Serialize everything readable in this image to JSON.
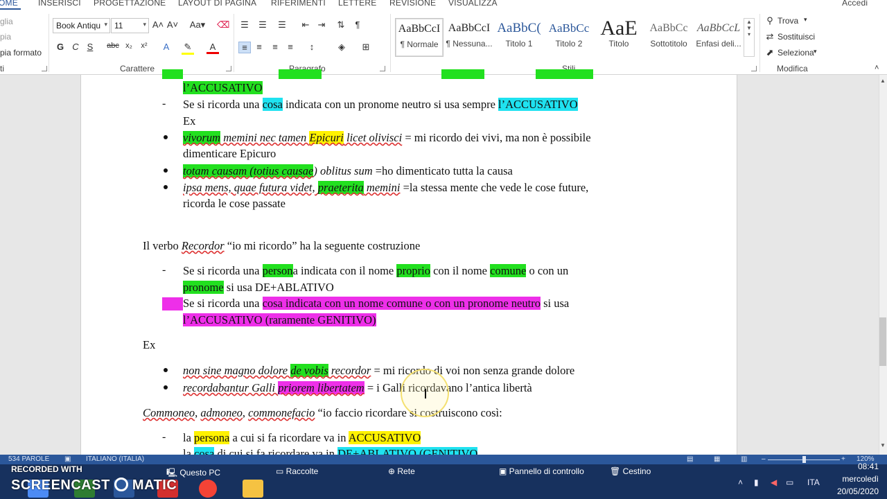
{
  "ribbon_tabs": [
    "OME",
    "INSERISCI",
    "PROGETTAZIONE",
    "LAYOUT DI PAGINA",
    "RIFERIMENTI",
    "LETTERE",
    "REVISIONE",
    "VISUALIZZA"
  ],
  "account": "Accedi",
  "clipboard": {
    "line1": "glia",
    "line2": "pia",
    "line3": "pia formato",
    "group": "ti"
  },
  "font": {
    "name": "Book Antiqu",
    "size": "11",
    "group": "Carattere"
  },
  "paragraph": {
    "group": "Paragrafo"
  },
  "styles": {
    "group": "Stili",
    "items": [
      {
        "preview": "AaBbCcI",
        "name": "¶ Normale"
      },
      {
        "preview": "AaBbCcI",
        "name": "¶ Nessuna..."
      },
      {
        "preview": "AaBbC(",
        "name": "Titolo 1"
      },
      {
        "preview": "AaBbCc",
        "name": "Titolo 2"
      },
      {
        "preview": "AaE",
        "name": "Titolo"
      },
      {
        "preview": "AaBbCc",
        "name": "Sottotitolo"
      },
      {
        "preview": "AaBbCcL",
        "name": "Enfasi deli..."
      }
    ]
  },
  "edit": {
    "find": "Trova",
    "replace": "Sostituisci",
    "select": "Seleziona",
    "group": "Modifica"
  },
  "document": {
    "l0a": "l’ACCUSATIVO",
    "l1_pre": "Se si ricorda una ",
    "l1_hl": "cosa",
    "l1_mid": " indicata con un pronome neutro si usa sempre ",
    "l1_hl2": "l’ACCUSATIVO",
    "l2": "Ex",
    "l3_a": "vivorum",
    "l3_b": " memini nec tamen ",
    "l3_c": "Epicuri",
    "l3_d": " licet olivisci",
    "l3_e": "   = mi ricordo dei vivi, ma non è possibile",
    "l4": "dimenticare Epicuro",
    "l5_a": "totam causam (totius causae",
    "l5_b": ") oblitus sum",
    "l5_c": "   =ho dimenticato tutta la causa",
    "l6_a": "ipsa mens, quae futura videt, ",
    "l6_b": "praeterita",
    "l6_c": " memini",
    "l6_d": "    =la stessa mente che vede le cose future,",
    "l7": "ricorda le cose passate",
    "l8_a": "Il verbo ",
    "l8_b": "Recordor",
    "l8_c": " “io mi ricordo” ha la seguente costruzione",
    "l9_a": "Se si ricorda una ",
    "l9_b": "person",
    "l9_c": "a indicata con il nome ",
    "l9_d": "proprio",
    "l9_e": " con il nome ",
    "l9_f": "comune",
    "l9_g": " o con un",
    "l10_a": "pronome",
    "l10_b": " si usa DE+ABLATIVO",
    "l11_a": "Se si ricorda una ",
    "l11_b": "cosa indicata con un nome comune o con un pronome neutro",
    "l11_c": " si usa",
    "l12": "l’ACCUSATIVO (raramente GENITIVO)",
    "l13": "Ex",
    "l14_a": "non sine magno dolore ",
    "l14_b": "de vobis",
    "l14_c": " recordor",
    "l14_d": "   = mi ricordo di voi non senza grande dolore",
    "l15_a": "recordabantur Galli ",
    "l15_b": "priorem libertatem",
    "l15_c": "     = i Galli ricordavano l’antica libertà",
    "l16_a": "Commoneo",
    "l16_b": ", ",
    "l16_c": "admoneo",
    "l16_d": ", ",
    "l16_e": "commonefacio",
    "l16_f": " “io faccio ricordare si costruiscono così:",
    "l17_a": "la ",
    "l17_b": "persona",
    "l17_c": " a cui si fa ricordare va in ",
    "l17_d": "ACCUSATIVO",
    "l18_a": "la ",
    "l18_b": "cosa",
    "l18_c": " di cui si fa ricordare va in ",
    "l18_d": "DE+ABLATIVO (GENITIVO"
  },
  "status": {
    "words": "534 PAROLE",
    "lang": "ITALIANO (ITALIA)",
    "zoom": "120%"
  },
  "taskbar": {
    "links": [
      "Questo PC",
      "Raccolte",
      "Rete",
      "Pannello di controllo",
      "Cestino"
    ],
    "watermark_top": "RECORDED WITH",
    "watermark": "SCREENCAST",
    "watermark_b": "MATIC",
    "lang": "ITA",
    "time": "08:41",
    "day": "mercoledì",
    "date": "20/05/2020"
  },
  "colors": {
    "accent": "#2b579a",
    "taskbar": "#17315e",
    "green": "#22e01f",
    "cyan": "#1fe2f0",
    "yellow": "#fff200",
    "magenta": "#ee2fe9"
  }
}
